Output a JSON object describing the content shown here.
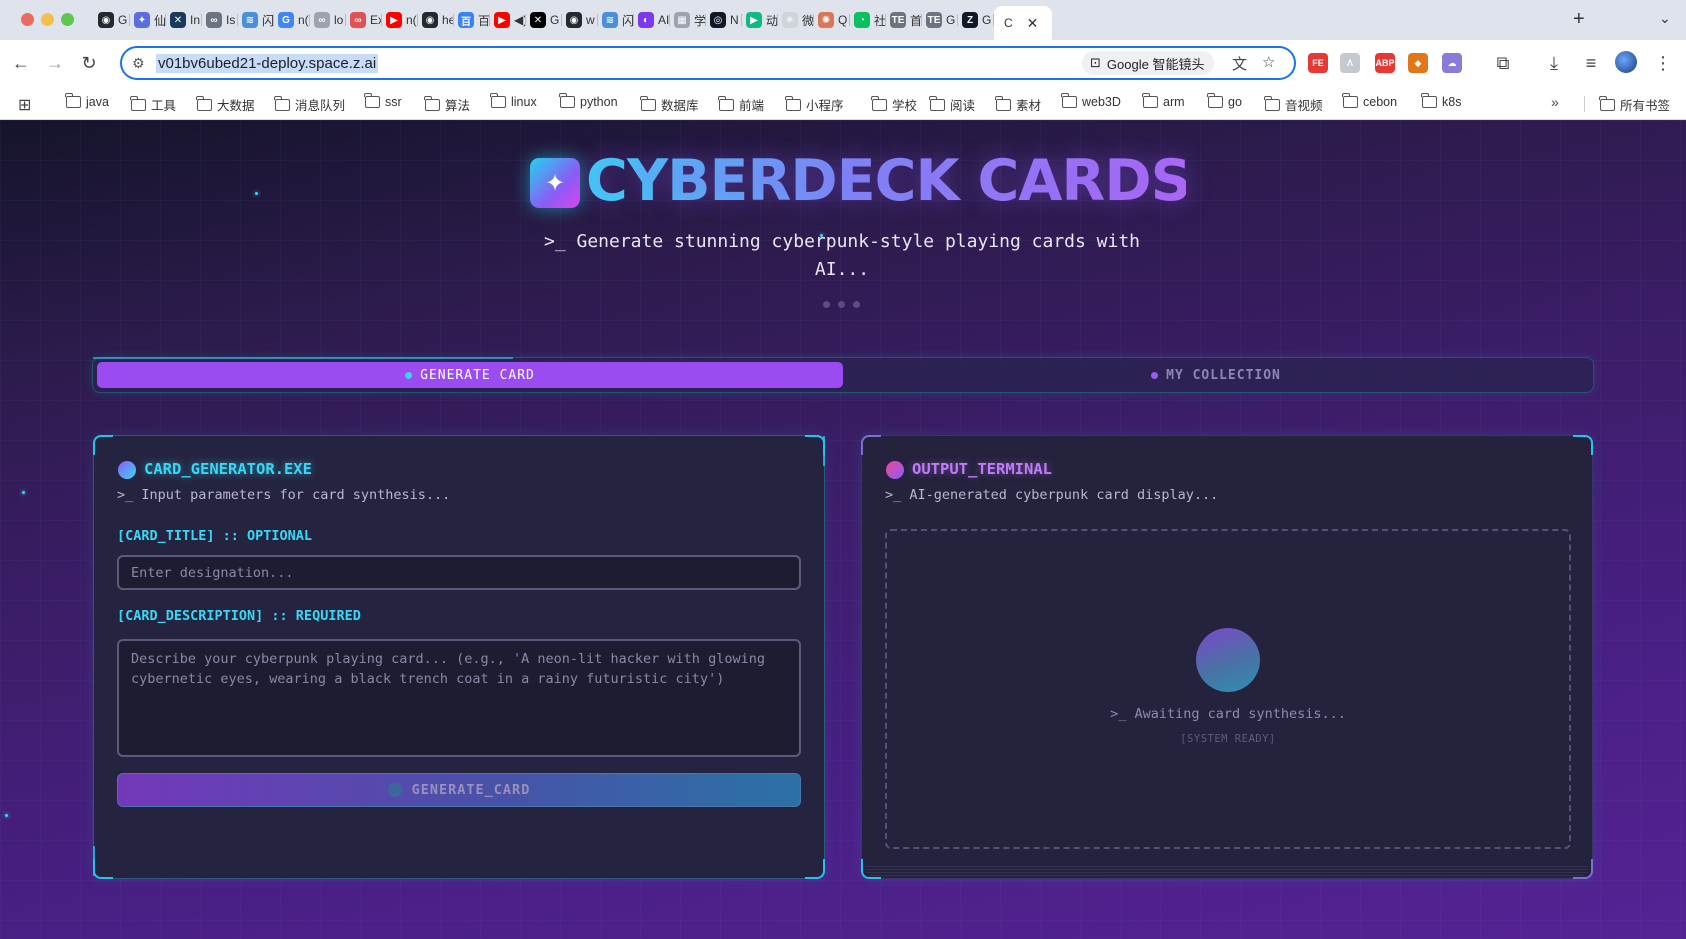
{
  "browser": {
    "tabs": [
      {
        "icon": "github-icon",
        "label": "G",
        "color": "#24292f",
        "glyph": "◉"
      },
      {
        "icon": "rocket-icon",
        "label": "仙",
        "color": "#5b6ee1",
        "glyph": "✦"
      },
      {
        "icon": "x-square-icon",
        "label": "In",
        "color": "#1b3a5c",
        "glyph": "✕"
      },
      {
        "icon": "link-icon",
        "label": "Is",
        "color": "#6b7280",
        "glyph": "∞"
      },
      {
        "icon": "tree-icon",
        "label": "闪",
        "color": "#4a90d9",
        "glyph": "≋"
      },
      {
        "icon": "google-icon",
        "label": "n(",
        "color": "#4285f4",
        "glyph": "G"
      },
      {
        "icon": "link-icon",
        "label": "lo",
        "color": "#9ca3af",
        "glyph": "∞"
      },
      {
        "icon": "link-icon",
        "label": "Ex",
        "color": "#e05252",
        "glyph": "∞"
      },
      {
        "icon": "youtube-icon",
        "label": "n(",
        "color": "#ff0000",
        "glyph": "▶"
      },
      {
        "icon": "github-icon",
        "label": "he",
        "color": "#24292f",
        "glyph": "◉"
      },
      {
        "icon": "chrome-ext-icon",
        "label": "百",
        "color": "#3b82f6",
        "glyph": "百"
      },
      {
        "icon": "youtube-icon",
        "label": "◀)",
        "color": "#ff0000",
        "glyph": "▶"
      },
      {
        "icon": "x-icon",
        "label": "G",
        "color": "#000000",
        "glyph": "✕"
      },
      {
        "icon": "github-icon",
        "label": "w",
        "color": "#24292f",
        "glyph": "◉"
      },
      {
        "icon": "tree-icon",
        "label": "闪",
        "color": "#4a90d9",
        "glyph": "≋"
      },
      {
        "icon": "ai-icon",
        "label": "AI",
        "color": "#7c3aed",
        "glyph": "◐"
      },
      {
        "icon": "image-icon",
        "label": "学",
        "color": "#9ca3af",
        "glyph": "▦"
      },
      {
        "icon": "openai-icon",
        "label": "N",
        "color": "#111827",
        "glyph": "◎"
      },
      {
        "icon": "play-icon",
        "label": "动",
        "color": "#10b981",
        "glyph": "▶"
      },
      {
        "icon": "sparkle-icon",
        "label": "微",
        "color": "#d1d5db",
        "glyph": "✳"
      },
      {
        "icon": "claude-icon",
        "label": "Q",
        "color": "#d97757",
        "glyph": "✺"
      },
      {
        "icon": "wechat-icon",
        "label": "社",
        "color": "#07c160",
        "glyph": "◔"
      },
      {
        "icon": "te-icon",
        "label": "首",
        "color": "#6b7280",
        "glyph": "TE"
      },
      {
        "icon": "te-icon",
        "label": "G",
        "color": "#6b7280",
        "glyph": "TE"
      },
      {
        "icon": "z-icon",
        "label": "G",
        "color": "#111827",
        "glyph": "Z"
      }
    ],
    "active_tab": {
      "label": "C",
      "close": "✕"
    },
    "new_tab": "+",
    "tab_menu": "⌄",
    "url": "v01bv6ubed21-deploy.space.z.ai",
    "lens_label": "Google 智能镜头",
    "bookmarks": [
      "java",
      "工具",
      "大数据",
      "消息队列",
      "ssr",
      "算法",
      "linux",
      "python",
      "数据库",
      "前端",
      "小程序",
      "学校",
      "阅读",
      "素材",
      "web3D",
      "arm",
      "go",
      "音视频",
      "cebon",
      "k8s"
    ],
    "all_bookmarks": "所有书签",
    "more_bookmarks": "»",
    "extensions": [
      {
        "name": "fe-ext-icon",
        "label": "FE",
        "color": "#e53935"
      },
      {
        "name": "arrow-ext-icon",
        "label": "Λ",
        "color": "#c5c8ce"
      },
      {
        "name": "adblock-icon",
        "label": "ABP",
        "color": "#e53935"
      },
      {
        "name": "metamask-icon",
        "label": "◆",
        "color": "#e2761b"
      },
      {
        "name": "cloud-ext-icon",
        "label": "☁",
        "color": "#8b7ad6"
      }
    ]
  },
  "hero": {
    "title": "CYBERDECK CARDS",
    "subtitle": ">_ Generate stunning cyberpunk-style playing cards with AI..."
  },
  "tabs": {
    "generate": "GENERATE CARD",
    "collection": "MY COLLECTION"
  },
  "generator": {
    "title": "CARD_GENERATOR.EXE",
    "subtitle": ">_ Input parameters for card synthesis...",
    "title_label": "[CARD_TITLE] :: OPTIONAL",
    "title_placeholder": "Enter designation...",
    "desc_label": "[CARD_DESCRIPTION] :: REQUIRED",
    "desc_placeholder": "Describe your cyberpunk playing card... (e.g., 'A neon-lit hacker with glowing cybernetic eyes, wearing a black trench coat in a rainy futuristic city')",
    "button": "GENERATE_CARD"
  },
  "output": {
    "title": "OUTPUT_TERMINAL",
    "subtitle": ">_ AI-generated cyberpunk card display...",
    "awaiting": ">_ Awaiting card synthesis...",
    "status": "[SYSTEM READY]"
  },
  "colors": {
    "accent_cyan": "#38d7f5",
    "accent_violet": "#9a4cf0",
    "panel_bg": "#252440"
  }
}
